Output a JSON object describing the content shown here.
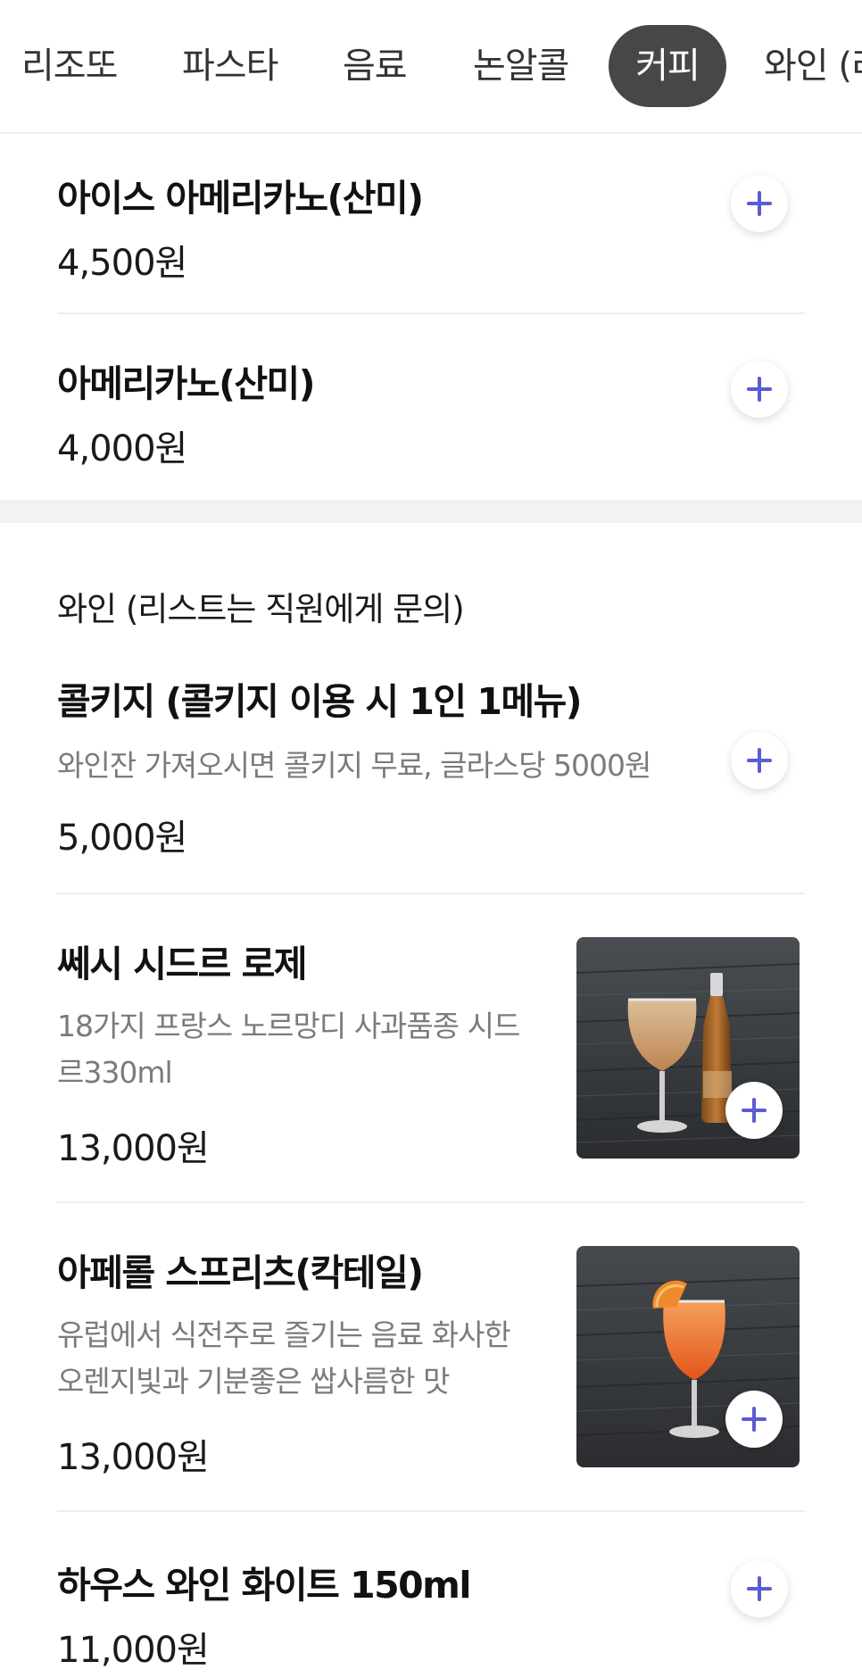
{
  "tabs": [
    {
      "label": "리조또",
      "active": false
    },
    {
      "label": "파스타",
      "active": false
    },
    {
      "label": "음료",
      "active": false
    },
    {
      "label": "논알콜",
      "active": false
    },
    {
      "label": "커피",
      "active": true
    },
    {
      "label": "와인 (리",
      "active": false
    }
  ],
  "coffee_items": [
    {
      "name": "아이스 아메리카노(산미)",
      "price": "4,500원"
    },
    {
      "name": "아메리카노(산미)",
      "price": "4,000원"
    }
  ],
  "wine_section": {
    "title": "와인 (리스트는 직원에게 문의)",
    "items": [
      {
        "name": "콜키지 (콜키지 이용 시 1인 1메뉴)",
        "desc": "와인잔 가져오시면 콜키지 무료, 글라스당 5000원",
        "price": "5,000원"
      },
      {
        "name": "쎄시 시드르 로제",
        "desc_lines": [
          "18가지 프랑스 노르망디 사과품종 시드",
          "르330ml"
        ],
        "price": "13,000원",
        "image": "cider-glass-and-bottle"
      },
      {
        "name": "아페롤 스프리츠(칵테일)",
        "desc_lines": [
          "유럽에서 식전주로 즐기는 음료 화사한",
          "오렌지빛과 기분좋은 쌉사름한 맛"
        ],
        "price": "13,000원",
        "image": "aperol-spritz-glass"
      },
      {
        "name": "하우스 와인 화이트 150ml",
        "price": "11,000원"
      }
    ]
  },
  "colors": {
    "accent": "#5b5bd6",
    "active_tab": "#474747",
    "divider": "#eeeeee"
  },
  "icons": {
    "add": "plus-icon"
  }
}
